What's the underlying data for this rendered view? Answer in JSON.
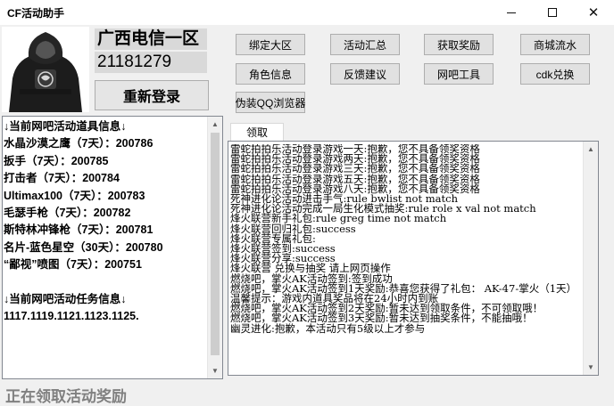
{
  "window": {
    "title": "CF活动助手",
    "controls": {
      "minimize": "minimize-icon",
      "maximize": "maximize-icon",
      "close": "close-icon"
    }
  },
  "account": {
    "server": "广西电信一区",
    "qq": "21181279",
    "relogin_label": "重新登录"
  },
  "toolbar": {
    "bind_region": "绑定大区",
    "activity_summary": "活动汇总",
    "claim_reward": "获取奖励",
    "mall_flow": "商城流水",
    "role_info": "角色信息",
    "feedback": "反馈建议",
    "netcafe_tools": "网吧工具",
    "cdk_redeem": "cdk兑换",
    "fake_qq_browser": "伪装QQ浏览器"
  },
  "left_panel": {
    "lines": [
      "↓当前网吧活动道具信息↓",
      "水晶沙漠之鹰（7天）：200786",
      "扳手（7天）：200785",
      "打击者（7天）：200784",
      "Ultimax100（7天）：200783",
      "毛瑟手枪（7天）：200782",
      "斯特林冲锋枪（7天）：200781",
      "名片-蓝色星空（30天）：200780",
      "“鄙视”喷图（7天）：200751",
      "",
      "↓当前网吧活动任务信息↓",
      "1117.1119.1121.1123.1125."
    ]
  },
  "log_tab": {
    "label": "领取"
  },
  "log": {
    "lines": [
      "雷蛇拍拍乐活动登录游戏一天:抱歉，您不具备领奖资格",
      "雷蛇拍拍乐活动登录游戏两天:抱歉，您不具备领奖资格",
      "雷蛇拍拍乐活动登录游戏三天:抱歉，您不具备领奖资格",
      "雷蛇拍拍乐活动登录游戏五天:抱歉，您不具备领奖资格",
      "雷蛇拍拍乐活动登录游戏八天:抱歉，您不具备领奖资格",
      "死神进化论活动进击手气:rule bwlist not match",
      "死神进化论活动完成一局生化模式抽奖:rule role x val not match",
      "烽火联营新手礼包:rule greg time not match",
      "烽火联营回归礼包:success",
      "烽火联营专属礼包:",
      "烽火联营签到:success",
      "烽火联营分享:success",
      "烽火联营 兑换与抽奖 请上网页操作",
      "燃烧吧，掌火AK活动签到:签到成功",
      "燃烧吧，掌火AK活动签到1天奖励:恭喜您获得了礼包： AK-47-掌火（1天）",
      "  温馨提示：游戏内道具奖品将在24小时内到账",
      "燃烧吧，掌火AK活动签到2天奖励:暂未达到领取条件，不可领取哦！",
      "燃烧吧，掌火AK活动签到3天奖励:暂未达到抽奖条件，不能抽哦！",
      "幽灵进化:抱歉，本活动只有5级以上才参与"
    ]
  },
  "status_bar": {
    "text": "正在领取活动奖励"
  }
}
